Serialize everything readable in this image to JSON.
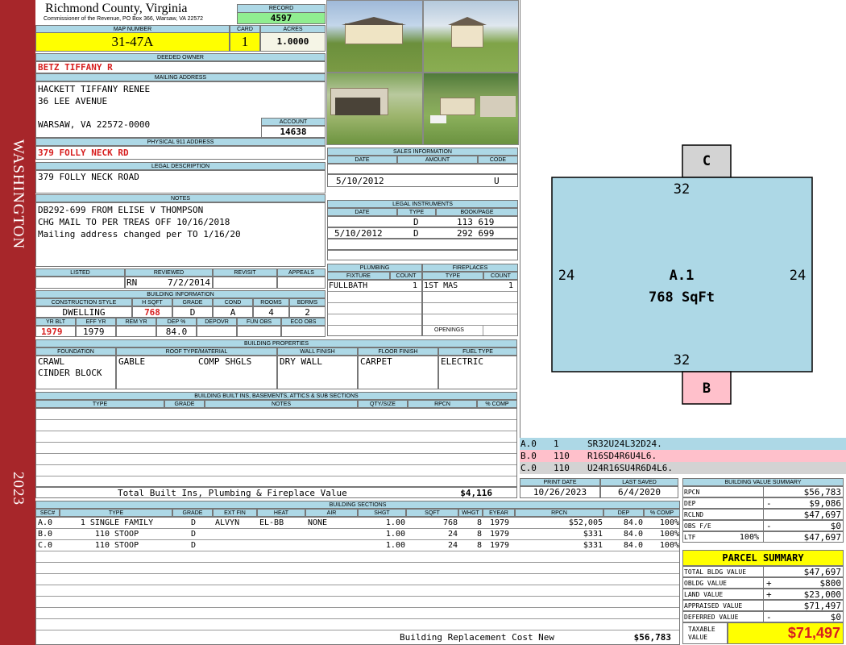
{
  "sidebar": {
    "town": "WASHINGTON",
    "year": "2023"
  },
  "header": {
    "county": "Richmond County, Virginia",
    "address": "Commissioner of the Revenue, PO Box 366, Warsaw, VA 22572",
    "record_label": "RECORD",
    "record": "4597",
    "map_label": "MAP NUMBER",
    "map": "31-47A",
    "card_label": "CARD",
    "card": "1",
    "acres_label": "ACRES",
    "acres": "1.0000"
  },
  "owner": {
    "label": "DEEDED OWNER",
    "name": "BETZ TIFFANY R"
  },
  "mailing": {
    "label": "MAILING ADDRESS",
    "line1": "HACKETT TIFFANY RENEE",
    "line2": "36 LEE AVENUE",
    "line3": "WARSAW, VA 22572-0000",
    "account_label": "ACCOUNT",
    "account": "14638"
  },
  "physical": {
    "label": "PHYSICAL 911 ADDRESS",
    "value": "379 FOLLY NECK RD"
  },
  "legal": {
    "label": "LEGAL DESCRIPTION",
    "value": "379 FOLLY NECK ROAD"
  },
  "notes": {
    "label": "NOTES",
    "lines": [
      "DB292-699 FROM ELISE V THOMPSON",
      "CHG MAIL TO PER TREAS OFF 10/16/2018",
      "Mailing address changed per TO 1/16/20"
    ]
  },
  "review": {
    "listed": "LISTED",
    "reviewed": "REVIEWED",
    "revisit": "REVISIT",
    "appeals": "APPEALS",
    "by": "RN",
    "date": "7/2/2014"
  },
  "building_info": {
    "label": "BUILDING INFORMATION",
    "h1": "CONSTRUCTION STYLE",
    "h2": "H SQFT",
    "h3": "GRADE",
    "h4": "COND",
    "h5": "ROOMS",
    "h6": "BDRMS",
    "v1": "DWELLING",
    "v2": "768",
    "v3": "D",
    "v4": "A",
    "v5": "4",
    "v6": "2",
    "h7": "YR BLT",
    "h8": "EFF YR",
    "h9": "REM YR",
    "h10": "DEP %",
    "h11": "DEPOVR",
    "h12": "FUN OBS",
    "h13": "ECO OBS",
    "v7": "1979",
    "v8": "1979",
    "v9": "",
    "v10": "84.0"
  },
  "sales": {
    "label": "SALES INFORMATION",
    "h_date": "DATE",
    "h_amount": "AMOUNT",
    "h_code": "CODE",
    "date": "5/10/2012",
    "code": "U"
  },
  "legal_instruments": {
    "label": "LEGAL INSTRUMENTS",
    "h_date": "DATE",
    "h_type": "TYPE",
    "h_book": "BOOK/PAGE",
    "rows": [
      {
        "date": "",
        "type": "D",
        "book": "113 619"
      },
      {
        "date": "5/10/2012",
        "type": "D",
        "book": "292 699"
      }
    ]
  },
  "plumbing": {
    "label": "PLUMBING",
    "h_fixture": "FIXTURE",
    "h_count": "COUNT",
    "fixture": "FULLBATH",
    "count": "1"
  },
  "fireplaces": {
    "label": "FIREPLACES",
    "h_type": "TYPE",
    "h_count": "COUNT",
    "type": "1ST MAS",
    "count": "1",
    "openings": "OPENINGS"
  },
  "properties": {
    "label": "BUILDING PROPERTIES",
    "foundation": "FOUNDATION",
    "roof": "ROOF TYPE/MATERIAL",
    "wall": "WALL FINISH",
    "floor": "FLOOR FINISH",
    "fuel": "FUEL TYPE",
    "f1": "CRAWL",
    "f2": "CINDER BLOCK",
    "r1": "GABLE",
    "r2": "COMP SHGLS",
    "w1": "DRY WALL",
    "fl1": "CARPET",
    "fu1": "ELECTRIC"
  },
  "builtins": {
    "label": "BUILDING BUILT INS, BASEMENTS, ATTICS & SUB SECTIONS",
    "h_type": "TYPE",
    "h_grade": "GRADE",
    "h_notes": "NOTES",
    "h_qty": "QTY/SIZE",
    "h_rpcn": "RPCN",
    "h_comp": "% COMP",
    "total_label": "Total Built Ins, Plumbing & Fireplace Value",
    "total": "$4,116"
  },
  "sections": {
    "label": "BUILDING SECTIONS",
    "headers": [
      "SEC#",
      "TYPE",
      "GRADE",
      "EXT FIN",
      "HEAT",
      "AIR",
      "SHGT",
      "SQFT",
      "WHGT",
      "EYEAR",
      "RPCN",
      "DEP",
      "% COMP"
    ],
    "rows": [
      {
        "sec": "A.0",
        "type": "1 SINGLE FAMILY",
        "grade": "D",
        "ext": "ALVYN",
        "heat": "EL-BB",
        "air": "NONE",
        "shgt": "1.00",
        "sqft": "768",
        "whgt": "8",
        "eyear": "1979",
        "rpcn": "$52,005",
        "dep": "84.0",
        "comp": "100%"
      },
      {
        "sec": "B.0",
        "type": "110 STOOP",
        "grade": "D",
        "ext": "",
        "heat": "",
        "air": "",
        "shgt": "1.00",
        "sqft": "24",
        "whgt": "8",
        "eyear": "1979",
        "rpcn": "$331",
        "dep": "84.0",
        "comp": "100%"
      },
      {
        "sec": "C.0",
        "type": "110 STOOP",
        "grade": "D",
        "ext": "",
        "heat": "",
        "air": "",
        "shgt": "1.00",
        "sqft": "24",
        "whgt": "8",
        "eyear": "1979",
        "rpcn": "$331",
        "dep": "84.0",
        "comp": "100%"
      }
    ],
    "replacement_label": "Building Replacement Cost New",
    "replacement": "$56,783"
  },
  "sketch": {
    "main_label": "A.1",
    "main_area": "768 SqFt",
    "top": "32",
    "bottom": "32",
    "left": "24",
    "right": "24",
    "c_label": "C",
    "b_label": "B",
    "colors": {
      "main": "#add8e6",
      "c": "#d3d3d3",
      "b": "#ffc0cb"
    }
  },
  "sketch_codes": [
    {
      "sec": "A.0",
      "code": "1",
      "vector": "SR32U24L32D24.",
      "color": "#add8e6"
    },
    {
      "sec": "B.0",
      "code": "110",
      "vector": "R16SD4R6U4L6.",
      "color": "#ffc0cb"
    },
    {
      "sec": "C.0",
      "code": "110",
      "vector": "U24R16SU4R6D4L6.",
      "color": "#d3d3d3"
    }
  ],
  "dates": {
    "print_label": "PRINT DATE",
    "print": "10/26/2023",
    "saved_label": "LAST SAVED",
    "saved": "6/4/2020"
  },
  "value_summary": {
    "label": "BUILDING VALUE SUMMARY",
    "rows": [
      {
        "name": "RPCN",
        "sign": "",
        "pct": "",
        "value": "$56,783"
      },
      {
        "name": "DEP",
        "sign": "-",
        "pct": "",
        "value": "$9,086"
      },
      {
        "name": "RCLND",
        "sign": "",
        "pct": "",
        "value": "$47,697"
      },
      {
        "name": "OBS F/E",
        "sign": "-",
        "pct": "",
        "value": "$0"
      },
      {
        "name": "LTF",
        "sign": "",
        "pct": "100%",
        "value": "$47,697"
      }
    ]
  },
  "parcel": {
    "label": "PARCEL SUMMARY",
    "rows": [
      {
        "name": "TOTAL BLDG VALUE",
        "sign": "",
        "value": "$47,697"
      },
      {
        "name": "OBLDG VALUE",
        "sign": "+",
        "value": "$800"
      },
      {
        "name": "LAND VALUE",
        "sign": "+",
        "value": "$23,000"
      },
      {
        "name": "APPRAISED VALUE",
        "sign": "",
        "value": "$71,497"
      },
      {
        "name": "DEFERRED VALUE",
        "sign": "-",
        "value": "$0"
      }
    ],
    "taxable_label1": "TAXABLE",
    "taxable_label2": "VALUE",
    "taxable": "$71,497"
  }
}
